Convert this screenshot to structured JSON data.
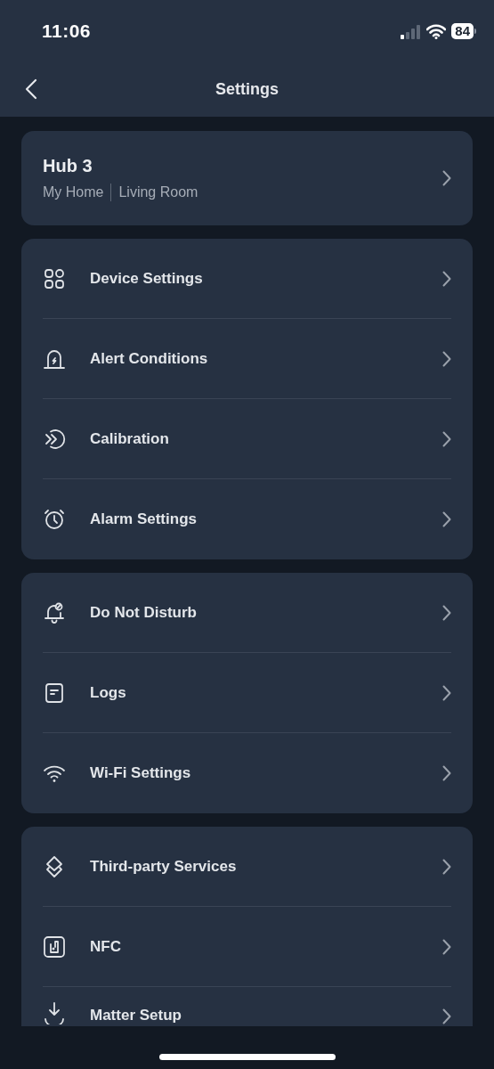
{
  "status_bar": {
    "time": "11:06",
    "battery": "84"
  },
  "nav": {
    "title": "Settings"
  },
  "device": {
    "name": "Hub 3",
    "home": "My Home",
    "room": "Living Room"
  },
  "sections": [
    {
      "items": [
        {
          "label": "Device Settings"
        },
        {
          "label": "Alert Conditions"
        },
        {
          "label": "Calibration"
        },
        {
          "label": "Alarm Settings"
        }
      ]
    },
    {
      "items": [
        {
          "label": "Do Not Disturb"
        },
        {
          "label": "Logs"
        },
        {
          "label": "Wi-Fi Settings"
        }
      ]
    },
    {
      "items": [
        {
          "label": "Third-party Services"
        },
        {
          "label": "NFC"
        },
        {
          "label": "Matter Setup"
        }
      ]
    }
  ]
}
